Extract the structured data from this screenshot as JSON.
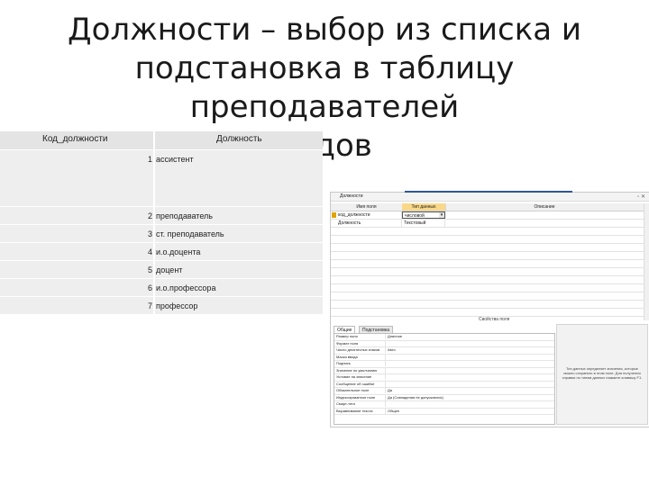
{
  "slide": {
    "title_lines": [
      "Должности – выбор из списка и",
      "подстановка в таблицу преподавателей",
      "кодов"
    ]
  },
  "left_table": {
    "headers": [
      "Код_должности",
      "Должность"
    ],
    "rows": [
      {
        "num": "1",
        "text": "ассистент"
      },
      {
        "num": "2",
        "text": "преподаватель"
      },
      {
        "num": "3",
        "text": "ст. преподаватель"
      },
      {
        "num": "4",
        "text": "и.о.доцента"
      },
      {
        "num": "5",
        "text": "доцент"
      },
      {
        "num": "6",
        "text": "и.о.профессора"
      },
      {
        "num": "7",
        "text": "профессор"
      }
    ]
  },
  "design_window": {
    "tab_name": "Должности",
    "window_controls": "▫ ✕",
    "grid_headers": [
      "Имя поля",
      "Тип данных",
      "Описание"
    ],
    "fields": [
      {
        "name": "код_должности",
        "type": "числовой"
      },
      {
        "name": "Должность",
        "type": "Текстовый"
      }
    ],
    "dropdown_arrow": "▾",
    "props_caption": "Свойства поля",
    "prop_tabs": [
      "Общие",
      "Подстановка"
    ],
    "props": [
      {
        "label": "Размер поля",
        "value": "Длинное"
      },
      {
        "label": "Формат поля",
        "value": ""
      },
      {
        "label": "Число десятичных знаков",
        "value": "Авто"
      },
      {
        "label": "Маска ввода",
        "value": ""
      },
      {
        "label": "Подпись",
        "value": ""
      },
      {
        "label": "Значение по умолчанию",
        "value": ""
      },
      {
        "label": "Условие на значение",
        "value": ""
      },
      {
        "label": "Сообщение об ошибке",
        "value": ""
      },
      {
        "label": "Обязательное поле",
        "value": "Да"
      },
      {
        "label": "Индексированное поле",
        "value": "Да (Совпадения не допускаются)"
      },
      {
        "label": "Смарт-теги",
        "value": ""
      },
      {
        "label": "Выравнивание текста",
        "value": "Общее"
      }
    ],
    "hint_text": "Тип данных определяет значения, которые можно сохранять в этом поле. Для получения справки по типам данных нажмите клавишу F1."
  }
}
